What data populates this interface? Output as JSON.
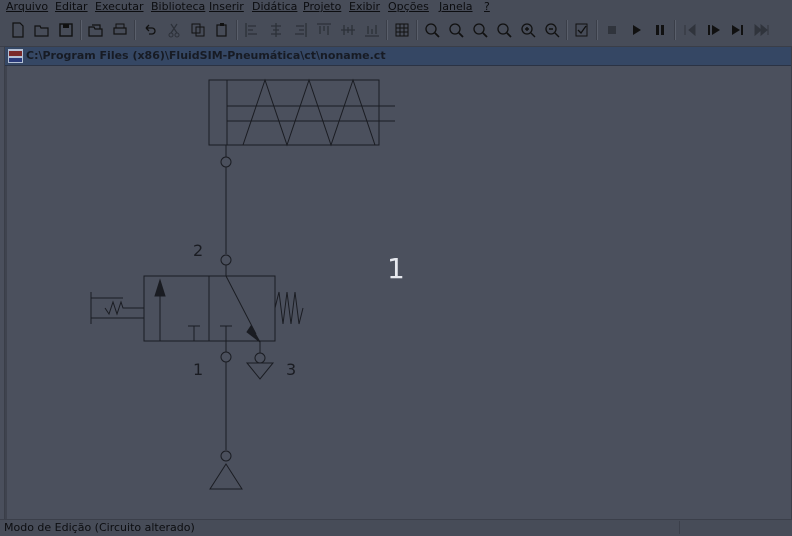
{
  "menu": [
    "Arquivo",
    "Editar",
    "Executar",
    "Biblioteca",
    "Inserir",
    "Didática",
    "Projeto",
    "Exibir",
    "Opções",
    "Janela",
    "?"
  ],
  "toolbar": {
    "icons": [
      "new-icon",
      "open-icon",
      "save-icon",
      "open-folder-icon",
      "print-icon",
      "undo-icon",
      "cut-icon",
      "copy-icon",
      "paste-icon",
      "align-left-icon",
      "align-center-icon",
      "align-right-icon",
      "align-top-icon",
      "align-middle-icon",
      "align-bottom-icon",
      "grid-icon",
      "zoom-1-1-icon",
      "zoom-fit-icon",
      "zoom-all-icon",
      "zoom-window-icon",
      "zoom-in-icon",
      "zoom-out-icon",
      "check-icon",
      "stop-icon",
      "play-icon",
      "pause-icon",
      "reset-icon",
      "step-icon",
      "step-end-icon",
      "fast-forward-icon"
    ]
  },
  "document": {
    "title": "C:\\Program Files (x86)\\FluidSIM-Pneumática\\ct\\noname.ct",
    "diagram": {
      "port_label_2": "2",
      "port_label_1": "1",
      "port_label_3": "3",
      "big_label": "1"
    }
  },
  "status": {
    "message": "Modo de Edição (Circuito alterado)"
  },
  "colors": {
    "background": "#4a4f5c",
    "line": "#1a1c22",
    "titlebar": "#354764"
  }
}
